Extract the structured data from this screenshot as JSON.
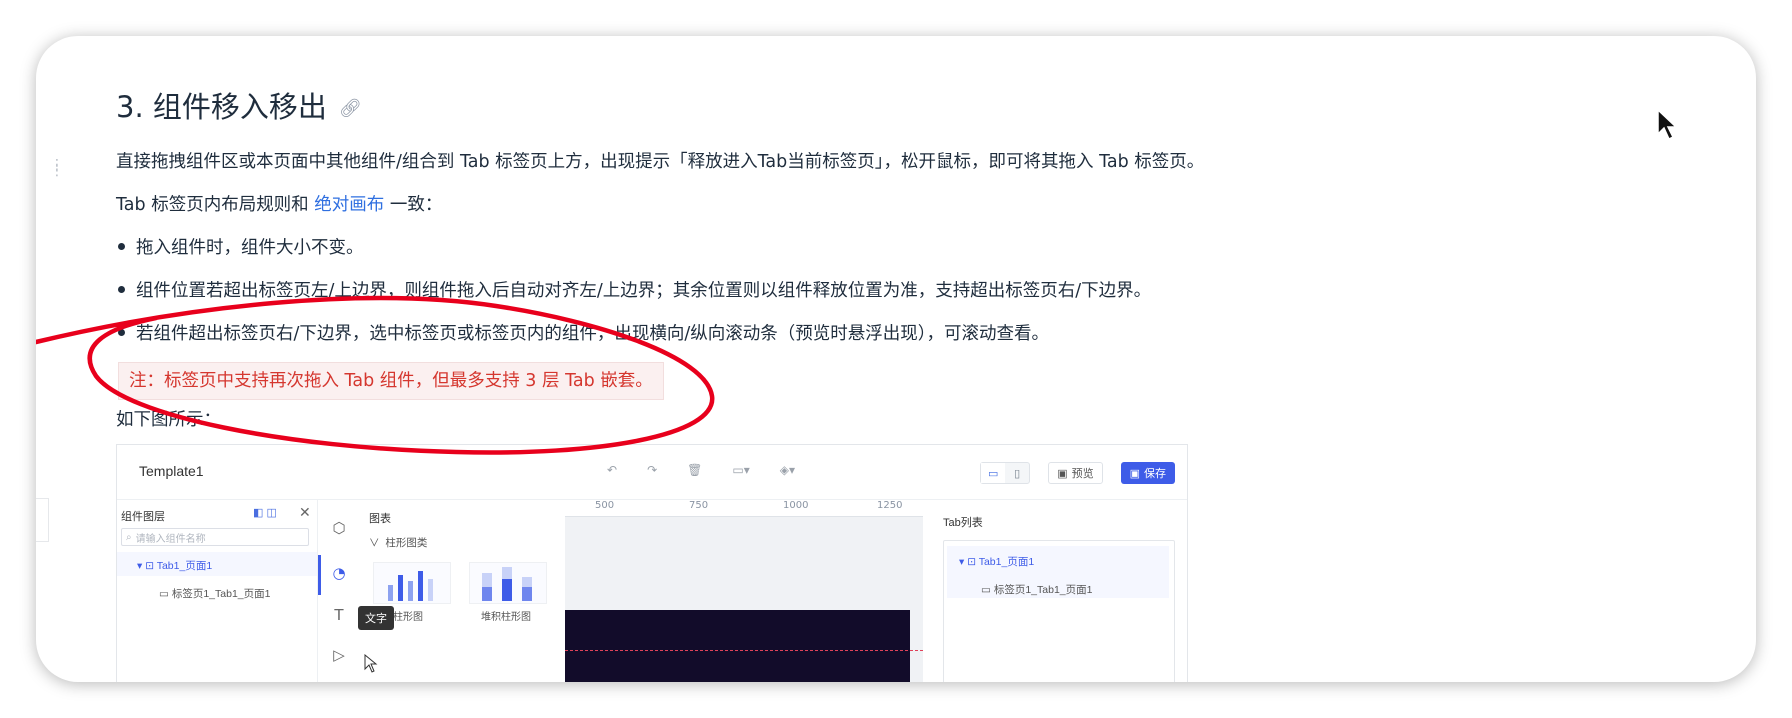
{
  "heading": {
    "text": "3. 组件移入移出"
  },
  "paragraph1": "直接拖拽组件区或本页面中其他组件/组合到 Tab 标签页上方，出现提示「释放进入Tab当前标签页」，松开鼠标，即可将其拖入 Tab 标签页。",
  "paragraph2": {
    "before": "Tab 标签页内布局规则和 ",
    "link": "绝对画布",
    "after": " 一致："
  },
  "bullets": [
    "拖入组件时，组件大小不变。",
    "组件位置若超出标签页左/上边界，则组件拖入后自动对齐左/上边界；其余位置则以组件释放位置为准，支持超出标签页右/下边界。",
    "若组件超出标签页右/下边界，选中标签页或标签页内的组件，出现横向/纵向滚动条（预览时悬浮出现），可滚动查看。"
  ],
  "note": "注：标签页中支持再次拖入 Tab 组件，但最多支持 3 层 Tab 嵌套。",
  "paragraph3": "如下图所示：",
  "colors": {
    "link": "#2f6fe0",
    "note_text": "#d5372f",
    "note_bg": "#fbf0f0",
    "annotation": "#e8001c",
    "accent": "#3e5ce8"
  },
  "screenshot": {
    "template_name": "Template1",
    "preview_label": "预览",
    "save_label": "保存",
    "layers_title": "组件图层",
    "search_placeholder": "请输入组件名称",
    "layer_items": [
      "Tab1_页面1",
      "标签页1_Tab1_页面1"
    ],
    "chart_panel_title": "图表",
    "chart_category": "柱形图类",
    "chart_thumbs": [
      "柱形图",
      "堆积柱形图"
    ],
    "tooltip": "文字",
    "ruler_ticks": [
      "500",
      "750",
      "1000",
      "1250"
    ],
    "tab_list_title": "Tab列表",
    "tab_list_items": [
      "Tab1_页面1",
      "标签页1_Tab1_页面1"
    ]
  }
}
